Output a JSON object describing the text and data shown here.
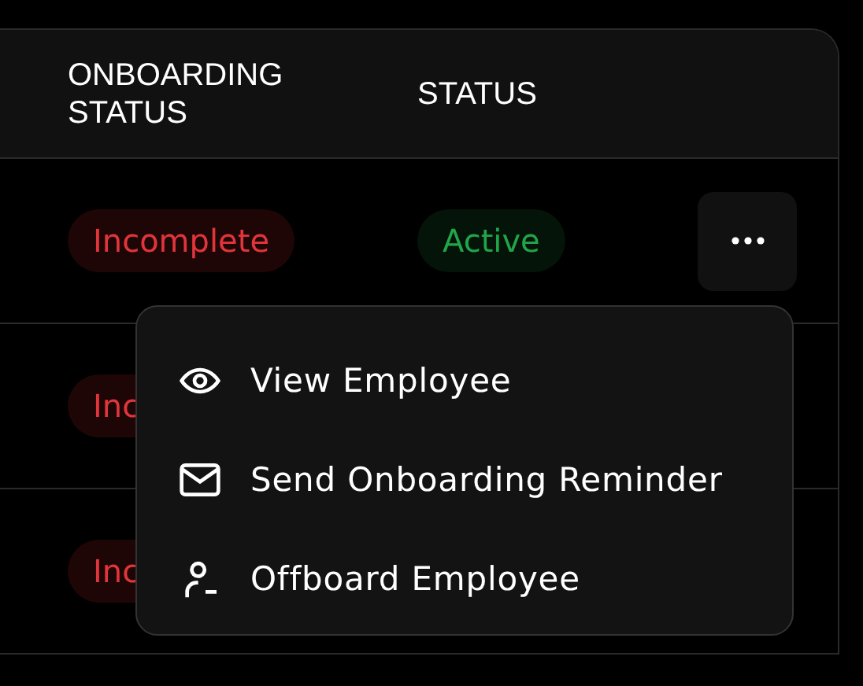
{
  "table": {
    "columns": [
      "ONBOARDING STATUS",
      "STATUS"
    ],
    "rows": [
      {
        "onboarding": {
          "text": "Incomplete",
          "kind": "danger"
        },
        "status": {
          "text": "Active",
          "kind": "success"
        },
        "has_actions": true
      },
      {
        "onboarding": {
          "text": "Inc",
          "kind": "danger"
        },
        "has_actions": false
      },
      {
        "onboarding": {
          "text": "Inc",
          "kind": "danger"
        },
        "has_actions": false
      }
    ]
  },
  "menu": {
    "items": [
      {
        "label": "View Employee",
        "kind": "view"
      },
      {
        "label": "Send Onboarding Reminder",
        "kind": "remind"
      },
      {
        "label": "Offboard Employee",
        "kind": "offboard"
      }
    ]
  }
}
